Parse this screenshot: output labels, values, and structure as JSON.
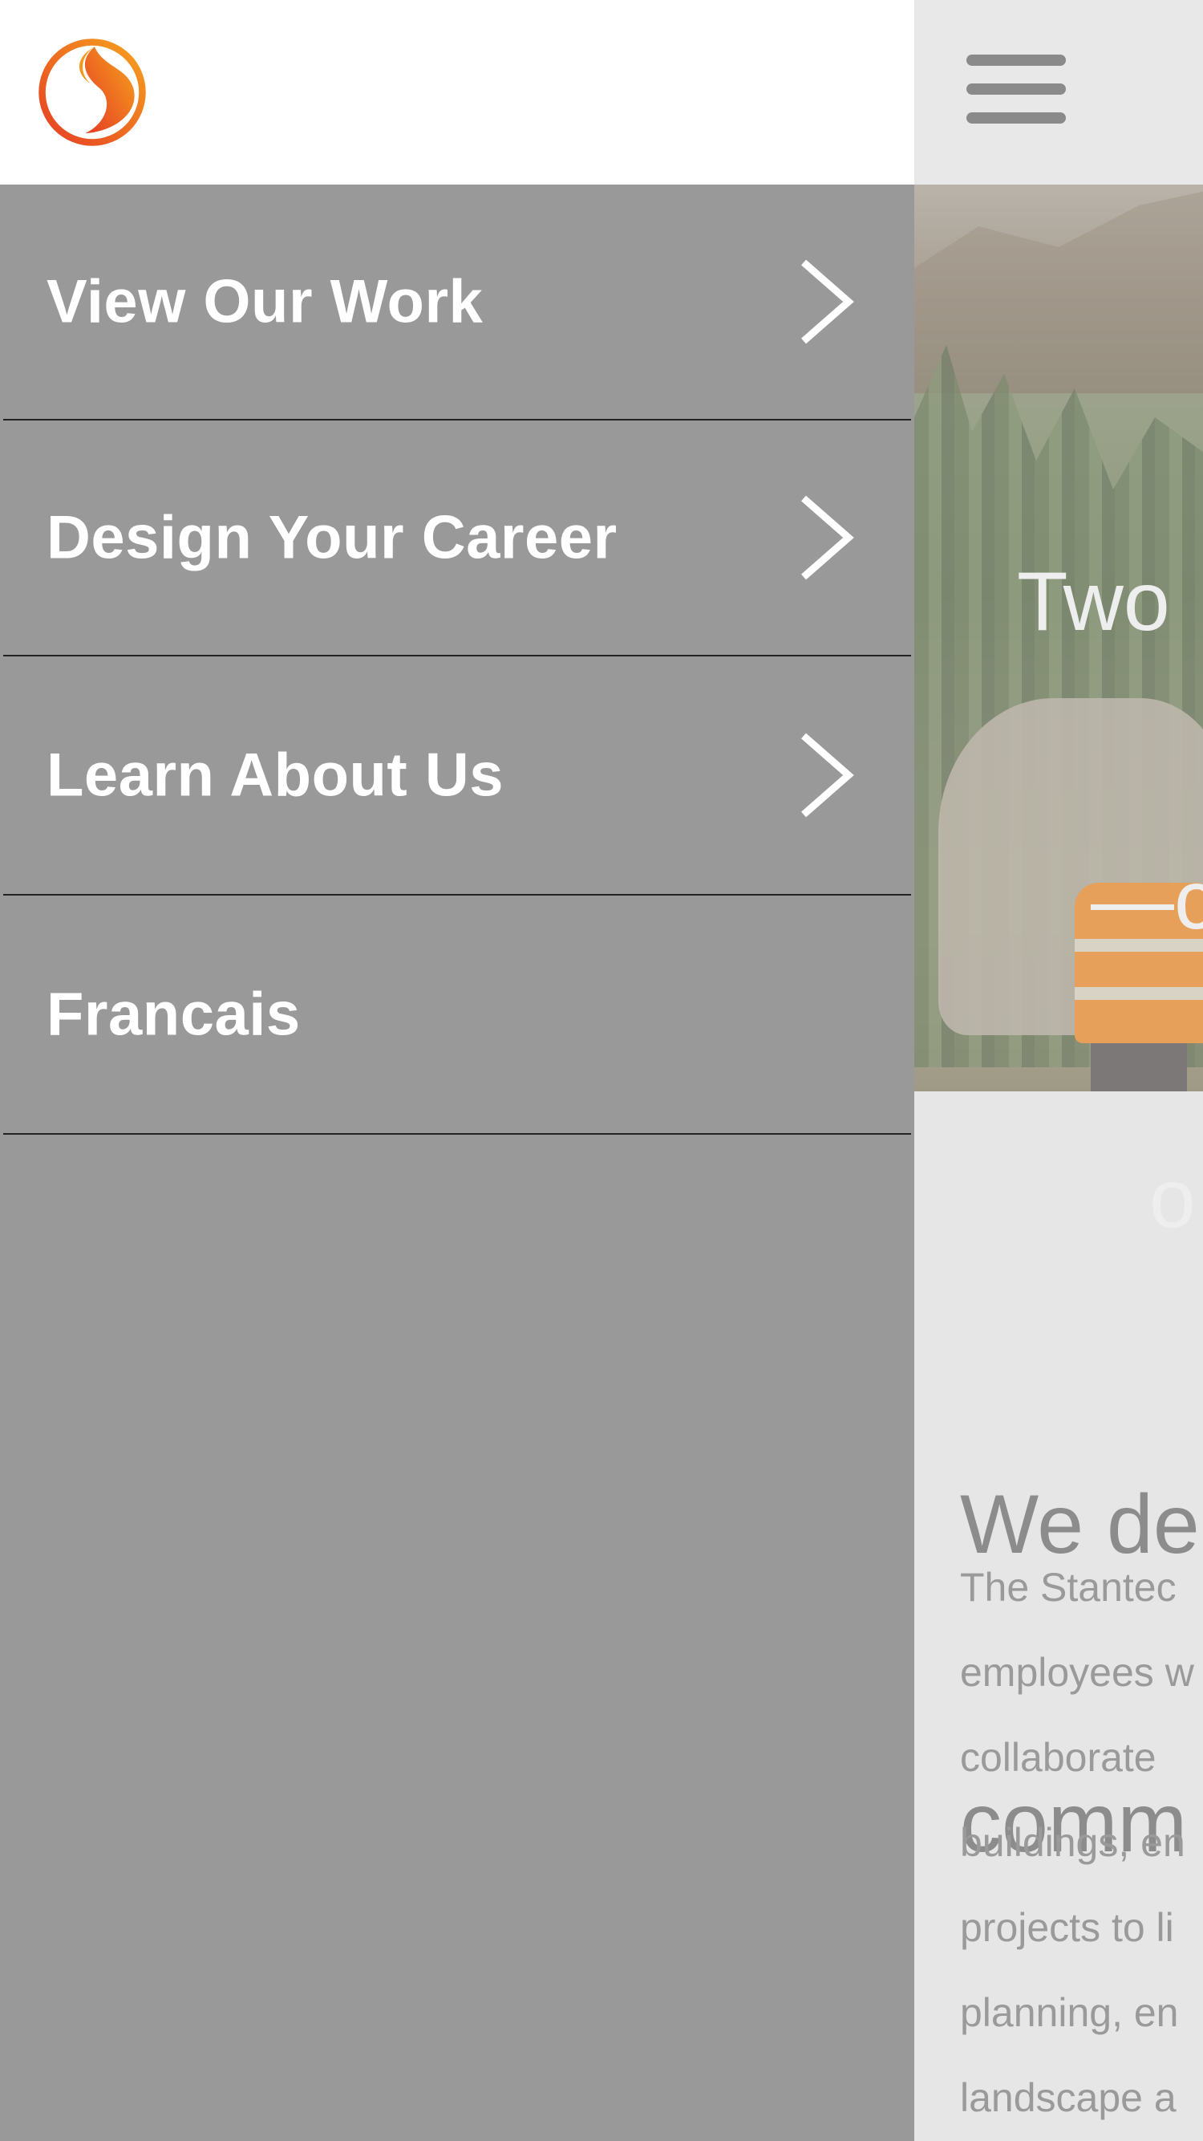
{
  "header": {
    "logo_icon": "stantec-flame-logo-icon",
    "menu_icon": "hamburger-menu-icon"
  },
  "hero": {
    "headline_lines": [
      "Two",
      "—c",
      "o"
    ]
  },
  "intro": {
    "heading_lines": [
      "We de",
      "comm"
    ],
    "body_lines": [
      "The Stantec",
      "employees w",
      "collaborate",
      "buildings, en",
      "projects to li",
      "planning, en",
      "landscape a"
    ]
  },
  "menu": {
    "items": [
      {
        "label": "View Our Work",
        "icon": "chevron-right-icon"
      },
      {
        "label": "Design Your Career",
        "icon": "chevron-right-icon"
      },
      {
        "label": "Learn About Us",
        "icon": "chevron-right-icon"
      },
      {
        "label": "Francais"
      }
    ]
  },
  "colors": {
    "menu_bg": "#999999",
    "header_bg": "#ffffff",
    "logo_orange": "#f39a1e",
    "logo_red": "#e53a24"
  }
}
